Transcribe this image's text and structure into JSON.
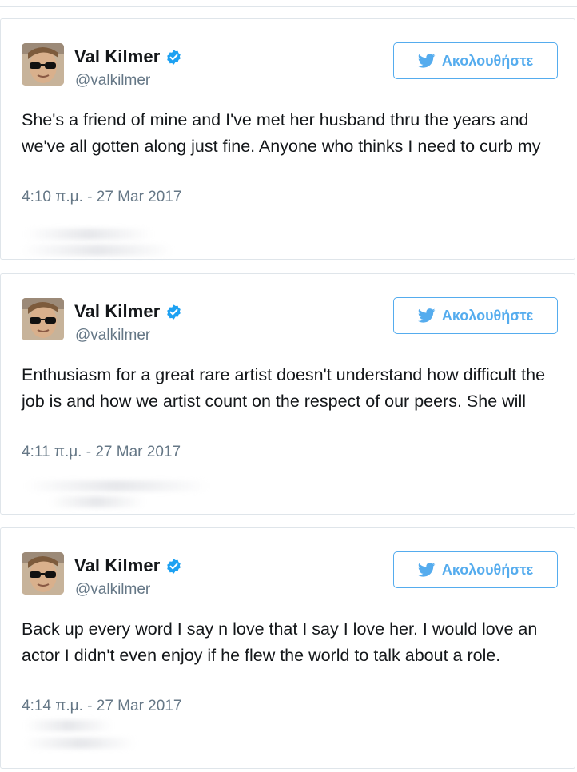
{
  "tweets": [
    {
      "name": "Val Kilmer",
      "handle": "@valkilmer",
      "follow_label": "Ακολουθήστε",
      "text": "She's a friend of mine and I've met her husband thru the years and we've all gotten along just fine. Anyone who thinks I need to curb my",
      "timestamp": "4:10 π.μ. - 27 Mar 2017"
    },
    {
      "name": "Val Kilmer",
      "handle": "@valkilmer",
      "follow_label": "Ακολουθήστε",
      "text": "Enthusiasm for a great rare artist doesn't understand how difficult the job is and how we artist count on the respect of our peers. She will",
      "timestamp": "4:11 π.μ. - 27 Mar 2017"
    },
    {
      "name": "Val Kilmer",
      "handle": "@valkilmer",
      "follow_label": "Ακολουθήστε",
      "text": "Back up every word I say n love that I say I love her. I would love an actor I didn't even enjoy if he flew the world to talk about a role.",
      "timestamp": "4:14 π.μ. - 27 Mar 2017"
    }
  ],
  "colors": {
    "accent": "#55acee",
    "text": "#14171a",
    "muted": "#657786",
    "border": "#dfe5ea",
    "verified": "#1da1f2"
  },
  "icons": {
    "verified": "verified-badge-icon",
    "follow": "twitter-bird-icon"
  }
}
